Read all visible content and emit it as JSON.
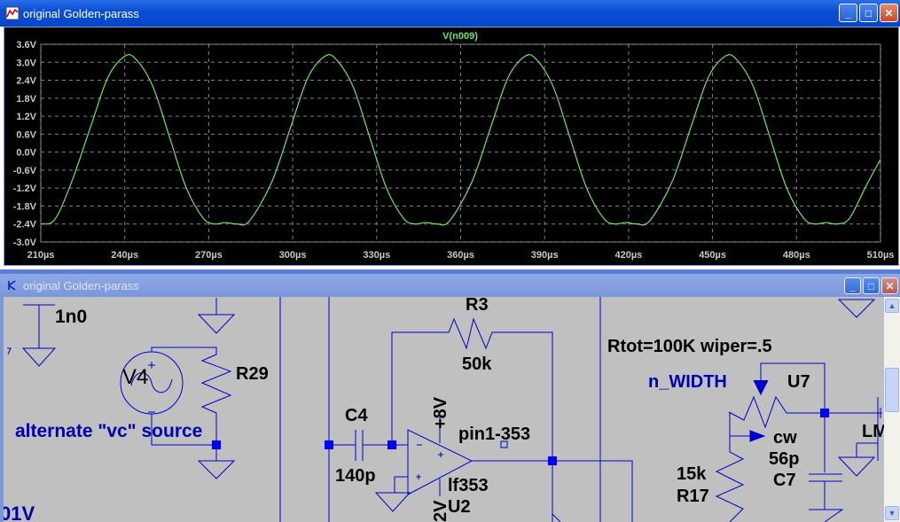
{
  "plot_window": {
    "title": "original Golden-parass",
    "buttons": [
      "minimize",
      "maximize",
      "close"
    ]
  },
  "schematic_window": {
    "title": "original Golden-parass",
    "buttons": [
      "minimize",
      "maximize",
      "close"
    ]
  },
  "chart_data": {
    "type": "line",
    "title": "V(n009)",
    "xlabel": "",
    "ylabel": "",
    "xlim": [
      210,
      510
    ],
    "ylim": [
      -3.0,
      3.6
    ],
    "x_ticks": [
      "210µs",
      "240µs",
      "270µs",
      "300µs",
      "330µs",
      "360µs",
      "390µs",
      "420µs",
      "450µs",
      "480µs",
      "510µs"
    ],
    "y_ticks": [
      "3.6V",
      "3.0V",
      "2.4V",
      "1.8V",
      "1.2V",
      "0.6V",
      "0.0V",
      "-0.6V",
      "-1.2V",
      "-1.8V",
      "-2.4V",
      "-3.0V"
    ],
    "grid": true,
    "colors": {
      "background": "#000000",
      "trace": "#6fe85a",
      "grid": "#808080",
      "title": "#6fe85a"
    },
    "series": [
      {
        "name": "V(n009)",
        "x": [
          210,
          215,
          221,
          228,
          234,
          240,
          244,
          250,
          256,
          262,
          268,
          272,
          276,
          280,
          284.5,
          292.5,
          299.5,
          305.5,
          311.5,
          315.5,
          321.5,
          327.5,
          333.5,
          339.5,
          343.5,
          347.5,
          351.5,
          356,
          364,
          371,
          377,
          383,
          387,
          393,
          399,
          405,
          411,
          415,
          419,
          423,
          427.5,
          435.5,
          442.5,
          448.5,
          454.5,
          458.5,
          464.5,
          470.5,
          476.5,
          482.5,
          486.5,
          490.5,
          494.5,
          499,
          505,
          510
        ],
        "y": [
          -2.4,
          -2.25,
          -1.0,
          0.9,
          2.5,
          3.2,
          3.1,
          2.2,
          0.5,
          -1.2,
          -2.2,
          -2.4,
          -2.35,
          -2.4,
          -2.3,
          -1.0,
          0.9,
          2.5,
          3.2,
          3.1,
          2.2,
          0.5,
          -1.2,
          -2.2,
          -2.4,
          -2.35,
          -2.4,
          -2.3,
          -1.0,
          0.9,
          2.5,
          3.2,
          3.1,
          2.2,
          0.5,
          -1.2,
          -2.2,
          -2.4,
          -2.35,
          -2.4,
          -2.3,
          -1.0,
          0.9,
          2.5,
          3.2,
          3.1,
          2.2,
          0.5,
          -1.2,
          -2.2,
          -2.4,
          -2.35,
          -2.4,
          -2.2,
          -1.1,
          -0.25
        ]
      }
    ]
  },
  "schematic": {
    "labels": {
      "c_top": "1n0",
      "v4": "V4",
      "r_overlap": "R29",
      "alt_source": "alternate \"vc\" source",
      "voltage_left": "01V",
      "r3": "R3",
      "r3_val": "50k",
      "c4": "C4",
      "c4_val": "140p",
      "plus8v": "+8V",
      "pin1": "pin1-353",
      "lf353": "lf353",
      "u2": "U2",
      "neg12v": "2V",
      "rtot": "Rtot=100K wiper=.5",
      "n_width": "n_WIDTH",
      "u7": "U7",
      "cw": "cw",
      "c7_val": "56p",
      "c7": "C7",
      "r17_val": "15k",
      "r17": "R17",
      "lm": "LM"
    },
    "colors": {
      "wire": "#0000cc",
      "junction": "#0000ff",
      "label": "#000000",
      "net_label": "#0000b0",
      "background": "#c0c0c0"
    }
  }
}
